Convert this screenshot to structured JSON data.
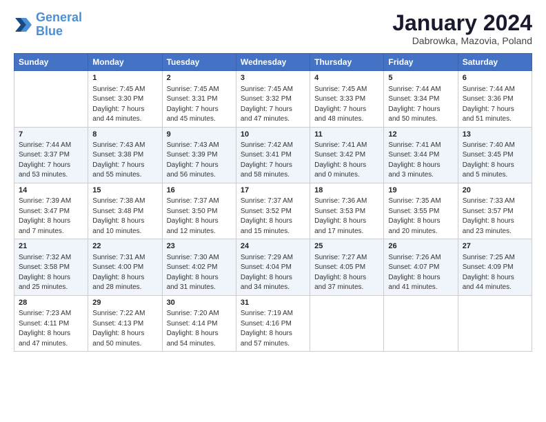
{
  "header": {
    "logo_line1": "General",
    "logo_line2": "Blue",
    "main_title": "January 2024",
    "subtitle": "Dabrowka, Mazovia, Poland"
  },
  "days_of_week": [
    "Sunday",
    "Monday",
    "Tuesday",
    "Wednesday",
    "Thursday",
    "Friday",
    "Saturday"
  ],
  "weeks": [
    [
      {
        "day": "",
        "sunrise": "",
        "sunset": "",
        "daylight": ""
      },
      {
        "day": "1",
        "sunrise": "Sunrise: 7:45 AM",
        "sunset": "Sunset: 3:30 PM",
        "daylight": "Daylight: 7 hours and 44 minutes."
      },
      {
        "day": "2",
        "sunrise": "Sunrise: 7:45 AM",
        "sunset": "Sunset: 3:31 PM",
        "daylight": "Daylight: 7 hours and 45 minutes."
      },
      {
        "day": "3",
        "sunrise": "Sunrise: 7:45 AM",
        "sunset": "Sunset: 3:32 PM",
        "daylight": "Daylight: 7 hours and 47 minutes."
      },
      {
        "day": "4",
        "sunrise": "Sunrise: 7:45 AM",
        "sunset": "Sunset: 3:33 PM",
        "daylight": "Daylight: 7 hours and 48 minutes."
      },
      {
        "day": "5",
        "sunrise": "Sunrise: 7:44 AM",
        "sunset": "Sunset: 3:34 PM",
        "daylight": "Daylight: 7 hours and 50 minutes."
      },
      {
        "day": "6",
        "sunrise": "Sunrise: 7:44 AM",
        "sunset": "Sunset: 3:36 PM",
        "daylight": "Daylight: 7 hours and 51 minutes."
      }
    ],
    [
      {
        "day": "7",
        "sunrise": "Sunrise: 7:44 AM",
        "sunset": "Sunset: 3:37 PM",
        "daylight": "Daylight: 7 hours and 53 minutes."
      },
      {
        "day": "8",
        "sunrise": "Sunrise: 7:43 AM",
        "sunset": "Sunset: 3:38 PM",
        "daylight": "Daylight: 7 hours and 55 minutes."
      },
      {
        "day": "9",
        "sunrise": "Sunrise: 7:43 AM",
        "sunset": "Sunset: 3:39 PM",
        "daylight": "Daylight: 7 hours and 56 minutes."
      },
      {
        "day": "10",
        "sunrise": "Sunrise: 7:42 AM",
        "sunset": "Sunset: 3:41 PM",
        "daylight": "Daylight: 7 hours and 58 minutes."
      },
      {
        "day": "11",
        "sunrise": "Sunrise: 7:41 AM",
        "sunset": "Sunset: 3:42 PM",
        "daylight": "Daylight: 8 hours and 0 minutes."
      },
      {
        "day": "12",
        "sunrise": "Sunrise: 7:41 AM",
        "sunset": "Sunset: 3:44 PM",
        "daylight": "Daylight: 8 hours and 3 minutes."
      },
      {
        "day": "13",
        "sunrise": "Sunrise: 7:40 AM",
        "sunset": "Sunset: 3:45 PM",
        "daylight": "Daylight: 8 hours and 5 minutes."
      }
    ],
    [
      {
        "day": "14",
        "sunrise": "Sunrise: 7:39 AM",
        "sunset": "Sunset: 3:47 PM",
        "daylight": "Daylight: 8 hours and 7 minutes."
      },
      {
        "day": "15",
        "sunrise": "Sunrise: 7:38 AM",
        "sunset": "Sunset: 3:48 PM",
        "daylight": "Daylight: 8 hours and 10 minutes."
      },
      {
        "day": "16",
        "sunrise": "Sunrise: 7:37 AM",
        "sunset": "Sunset: 3:50 PM",
        "daylight": "Daylight: 8 hours and 12 minutes."
      },
      {
        "day": "17",
        "sunrise": "Sunrise: 7:37 AM",
        "sunset": "Sunset: 3:52 PM",
        "daylight": "Daylight: 8 hours and 15 minutes."
      },
      {
        "day": "18",
        "sunrise": "Sunrise: 7:36 AM",
        "sunset": "Sunset: 3:53 PM",
        "daylight": "Daylight: 8 hours and 17 minutes."
      },
      {
        "day": "19",
        "sunrise": "Sunrise: 7:35 AM",
        "sunset": "Sunset: 3:55 PM",
        "daylight": "Daylight: 8 hours and 20 minutes."
      },
      {
        "day": "20",
        "sunrise": "Sunrise: 7:33 AM",
        "sunset": "Sunset: 3:57 PM",
        "daylight": "Daylight: 8 hours and 23 minutes."
      }
    ],
    [
      {
        "day": "21",
        "sunrise": "Sunrise: 7:32 AM",
        "sunset": "Sunset: 3:58 PM",
        "daylight": "Daylight: 8 hours and 25 minutes."
      },
      {
        "day": "22",
        "sunrise": "Sunrise: 7:31 AM",
        "sunset": "Sunset: 4:00 PM",
        "daylight": "Daylight: 8 hours and 28 minutes."
      },
      {
        "day": "23",
        "sunrise": "Sunrise: 7:30 AM",
        "sunset": "Sunset: 4:02 PM",
        "daylight": "Daylight: 8 hours and 31 minutes."
      },
      {
        "day": "24",
        "sunrise": "Sunrise: 7:29 AM",
        "sunset": "Sunset: 4:04 PM",
        "daylight": "Daylight: 8 hours and 34 minutes."
      },
      {
        "day": "25",
        "sunrise": "Sunrise: 7:27 AM",
        "sunset": "Sunset: 4:05 PM",
        "daylight": "Daylight: 8 hours and 37 minutes."
      },
      {
        "day": "26",
        "sunrise": "Sunrise: 7:26 AM",
        "sunset": "Sunset: 4:07 PM",
        "daylight": "Daylight: 8 hours and 41 minutes."
      },
      {
        "day": "27",
        "sunrise": "Sunrise: 7:25 AM",
        "sunset": "Sunset: 4:09 PM",
        "daylight": "Daylight: 8 hours and 44 minutes."
      }
    ],
    [
      {
        "day": "28",
        "sunrise": "Sunrise: 7:23 AM",
        "sunset": "Sunset: 4:11 PM",
        "daylight": "Daylight: 8 hours and 47 minutes."
      },
      {
        "day": "29",
        "sunrise": "Sunrise: 7:22 AM",
        "sunset": "Sunset: 4:13 PM",
        "daylight": "Daylight: 8 hours and 50 minutes."
      },
      {
        "day": "30",
        "sunrise": "Sunrise: 7:20 AM",
        "sunset": "Sunset: 4:14 PM",
        "daylight": "Daylight: 8 hours and 54 minutes."
      },
      {
        "day": "31",
        "sunrise": "Sunrise: 7:19 AM",
        "sunset": "Sunset: 4:16 PM",
        "daylight": "Daylight: 8 hours and 57 minutes."
      },
      {
        "day": "",
        "sunrise": "",
        "sunset": "",
        "daylight": ""
      },
      {
        "day": "",
        "sunrise": "",
        "sunset": "",
        "daylight": ""
      },
      {
        "day": "",
        "sunrise": "",
        "sunset": "",
        "daylight": ""
      }
    ]
  ]
}
